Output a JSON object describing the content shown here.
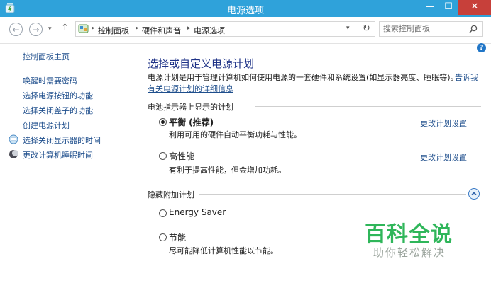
{
  "window": {
    "title": "电源选项",
    "minimize": "—",
    "maximize": "☐",
    "close": "✕"
  },
  "address": {
    "breadcrumb": [
      "控制面板",
      "硬件和声音",
      "电源选项"
    ],
    "search_placeholder": "搜索控制面板"
  },
  "sidebar": {
    "home": "控制面板主页",
    "links": [
      "唤醒时需要密码",
      "选择电源按钮的功能",
      "选择关闭盖子的功能",
      "创建电源计划",
      "选择关闭显示器的时间",
      "更改计算机睡眠时间"
    ]
  },
  "main": {
    "heading": "选择或自定义电源计划",
    "intro": "电源计划是用于管理计算机如何使用电源的一套硬件和系统设置(如显示器亮度、睡眠等)。",
    "intro_link_1": "告诉我",
    "intro_link_2": "有关电源计划的详细信息",
    "battery_section": "电池指示器上显示的计划",
    "hidden_section": "隐藏附加计划",
    "plans": [
      {
        "name": "平衡 (推荐)",
        "desc": "利用可用的硬件自动平衡功耗与性能。",
        "change": "更改计划设置",
        "selected": true
      },
      {
        "name": "高性能",
        "desc": "有利于提高性能，但会增加功耗。",
        "change": "更改计划设置",
        "selected": false
      },
      {
        "name": "Energy Saver",
        "desc": "",
        "selected": false
      },
      {
        "name": "节能",
        "desc": "尽可能降低计算机性能以节能。",
        "selected": false
      }
    ]
  },
  "watermark": {
    "main": "百科全说",
    "sub": "助你轻松解决"
  },
  "colors": {
    "titlebar": "#2fa2da",
    "close": "#c7403a",
    "link": "#1e4e8c",
    "heading": "#1e3287",
    "watermark": "#2fb65a"
  }
}
